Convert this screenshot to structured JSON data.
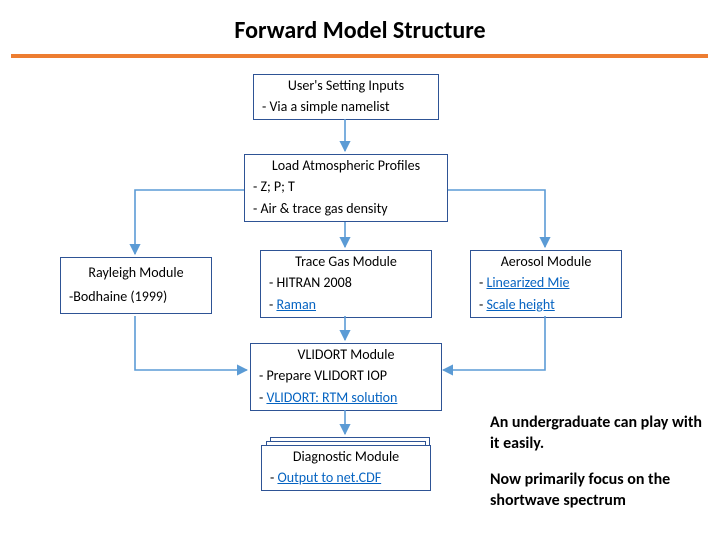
{
  "title": "Forward Model Structure",
  "boxes": {
    "inputs": {
      "hdr": "User's Setting Inputs",
      "rows": [
        "- Via a simple namelist"
      ]
    },
    "profiles": {
      "hdr": "Load Atmospheric Profiles",
      "rows": [
        "- Z; P; T",
        "- Air & trace gas density"
      ]
    },
    "rayleigh": {
      "hdr": "Rayleigh Module",
      "rows": [
        "-Bodhaine (1999)"
      ]
    },
    "tracegas": {
      "hdr": "Trace Gas Module",
      "rows": [
        "- HITRAN 2008",
        "- Raman"
      ],
      "link_rows": [
        1
      ]
    },
    "aerosol": {
      "hdr": "Aerosol Module",
      "rows": [
        "- Linearized Mie",
        "- Scale height"
      ],
      "link_rows": [
        0,
        1
      ]
    },
    "vlidort": {
      "hdr": "VLIDORT Module",
      "rows": [
        "- Prepare VLIDORT IOP",
        "- VLIDORT: RTM solution"
      ],
      "link_rows": [
        1
      ]
    },
    "diag": {
      "hdr": "Diagnostic Module",
      "rows": [
        "- Output to net.CDF"
      ],
      "link_rows": [
        0
      ]
    }
  },
  "notes": {
    "n1": "An undergraduate can play with it easily.",
    "n2": "Now primarily focus on the shortwave spectrum"
  },
  "chart_data": {
    "type": "diagram",
    "title": "Forward Model Structure",
    "nodes": [
      {
        "id": "inputs",
        "label": "User's Setting Inputs",
        "details": [
          "Via a simple namelist"
        ]
      },
      {
        "id": "profiles",
        "label": "Load Atmospheric Profiles",
        "details": [
          "Z; P; T",
          "Air & trace gas density"
        ]
      },
      {
        "id": "rayleigh",
        "label": "Rayleigh Module",
        "details": [
          "Bodhaine (1999)"
        ]
      },
      {
        "id": "tracegas",
        "label": "Trace Gas Module",
        "details": [
          "HITRAN 2008",
          "Raman"
        ]
      },
      {
        "id": "aerosol",
        "label": "Aerosol Module",
        "details": [
          "Linearized Mie",
          "Scale height"
        ]
      },
      {
        "id": "vlidort",
        "label": "VLIDORT Module",
        "details": [
          "Prepare VLIDORT IOP",
          "VLIDORT: RTM solution"
        ]
      },
      {
        "id": "diag",
        "label": "Diagnostic Module",
        "details": [
          "Output to net.CDF"
        ]
      }
    ],
    "edges": [
      {
        "from": "inputs",
        "to": "profiles"
      },
      {
        "from": "profiles",
        "to": "rayleigh"
      },
      {
        "from": "profiles",
        "to": "tracegas"
      },
      {
        "from": "profiles",
        "to": "aerosol"
      },
      {
        "from": "rayleigh",
        "to": "vlidort"
      },
      {
        "from": "tracegas",
        "to": "vlidort"
      },
      {
        "from": "aerosol",
        "to": "vlidort"
      },
      {
        "from": "vlidort",
        "to": "diag"
      }
    ],
    "annotations": [
      "An undergraduate can play with it easily.",
      "Now primarily focus on the shortwave spectrum"
    ]
  }
}
